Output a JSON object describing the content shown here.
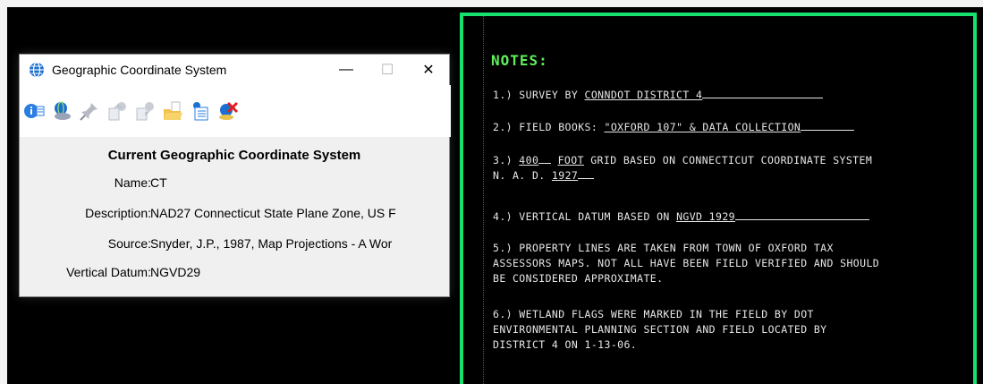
{
  "dialog": {
    "title": "Geographic Coordinate System",
    "controls": {
      "minimize": "—",
      "maximize": "☐",
      "close": "✕"
    },
    "toolbar": [
      "info-icon",
      "globe-disk-icon",
      "pin-icon",
      "export-icon",
      "import-icon",
      "open-folder-icon",
      "list-icon",
      "delete-icon"
    ],
    "heading": "Current Geographic Coordinate System",
    "fields": [
      {
        "label": "Name:",
        "value": "CT"
      },
      {
        "label": "Description:",
        "value": "NAD27 Connecticut State Plane Zone, US F"
      },
      {
        "label": "Source:",
        "value": "Snyder, J.P., 1987, Map Projections - A Wor"
      },
      {
        "label": "Vertical Datum:",
        "value": "NGVD29"
      }
    ]
  },
  "notes": {
    "title": "NOTES:",
    "n1_prefix": "1.) SURVEY BY ",
    "n1_value": "CONNDOT DISTRICT 4",
    "n2_prefix": "2.) FIELD BOOKS: ",
    "n2_value": "\"OXFORD 107\" & DATA COLLECTION",
    "n3_prefix": "3.) ",
    "n3_value1": "400",
    "n3_mid": " ",
    "n3_value2": "FOOT",
    "n3_rest": " GRID BASED ON CONNECTICUT COORDINATE SYSTEM",
    "n3_line2_prefix": "N. A. D. ",
    "n3_line2_value": "1927",
    "n4_prefix": "4.) VERTICAL DATUM BASED ON ",
    "n4_value": "NGVD 1929",
    "n5_line1": "5.) PROPERTY LINES ARE TAKEN FROM TOWN OF OXFORD TAX",
    "n5_line2": "ASSESSORS MAPS. NOT ALL HAVE BEEN FIELD VERIFIED AND SHOULD",
    "n5_line3": "BE CONSIDERED APPROXIMATE.",
    "n6_line1": "6.) WETLAND FLAGS WERE MARKED IN THE FIELD BY DOT",
    "n6_line2": "ENVIRONMENTAL PLANNING SECTION AND FIELD LOCATED BY",
    "n6_line3": "DISTRICT 4 ON 1-13-06."
  }
}
